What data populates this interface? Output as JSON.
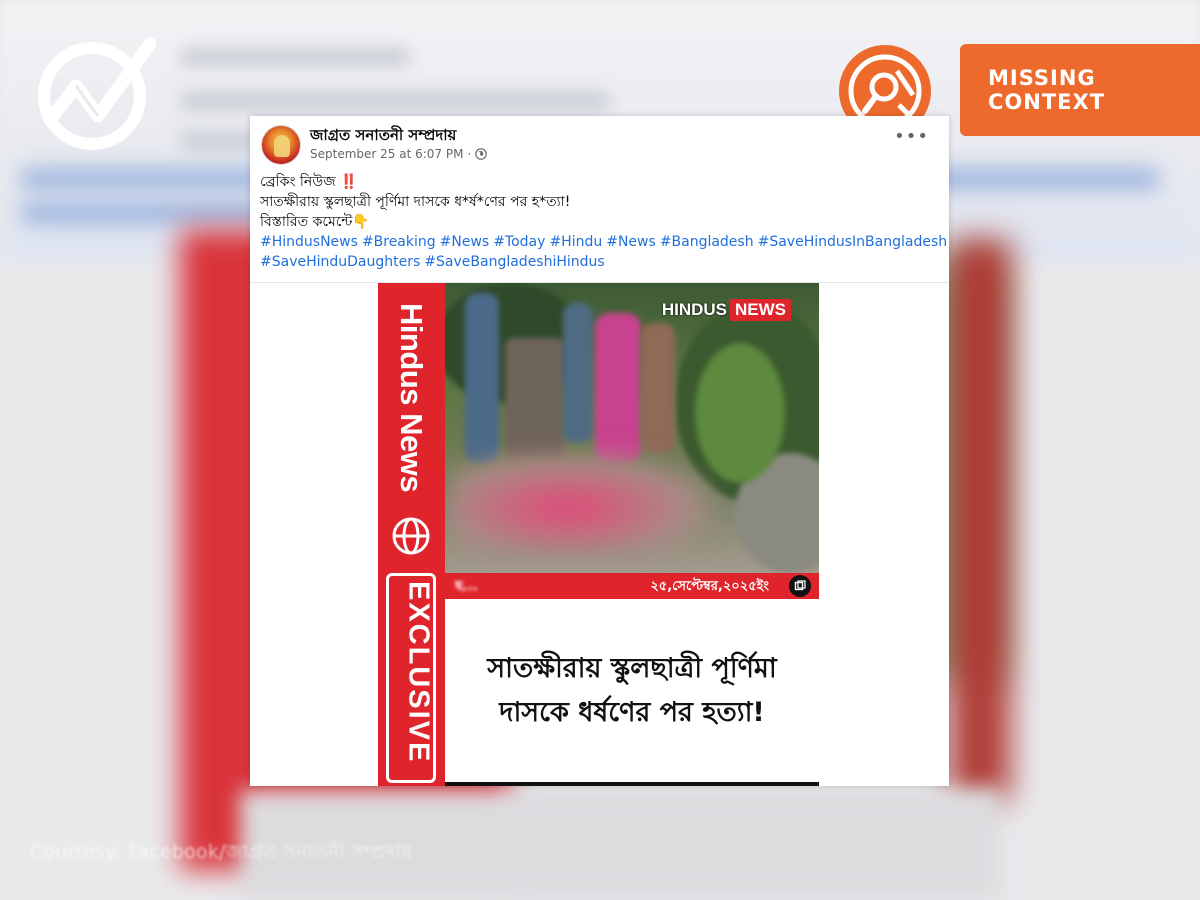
{
  "background": {
    "courtesy": "Courtesy: Facebook/জাগ্রত সনাতনী সম্প্রদায়"
  },
  "badge": {
    "label": "MISSING CONTEXT",
    "accent": "#ee6a2c",
    "icon": "magnifier-icon"
  },
  "site_logo": {
    "icon": "check-chart-logo"
  },
  "post": {
    "page_name": "জাগ্রত সনাতনী সম্প্রদায়",
    "timestamp": "September 25 at 6:07 PM",
    "separator": "·",
    "privacy_icon": "globe-icon",
    "more_label": "•••",
    "text": {
      "line1": "ব্রেকিং নিউজ",
      "alert": "‼️",
      "line2": "সাতক্ষীরায় স্কুলছাত্রী পূর্ণিমা দাসকে ধ*র্ষ*ণের পর হ*ত্যা!",
      "line3": "বিস্তারিত কমেন্টে👇"
    },
    "hashtags": [
      "#HindusNews",
      "#Breaking",
      "#News",
      "#Today",
      "#Hindu",
      "#News",
      "#Bangladesh",
      "#SaveHindusInBangladesh",
      "#SaveHinduDaughters",
      "#SaveBangladeshiHindus"
    ],
    "link_color": "#216fdb"
  },
  "media": {
    "side_brand": "Hindus News",
    "side_exclusive": "EXCLUSIVE",
    "tag_white": "HINDUS",
    "tag_red": "NEWS",
    "caption_left": "ছ...",
    "caption_date": "২৫,সেপ্টেম্বর,২০২৫ইং",
    "headline": "সাতক্ষীরায় স্কুলছাত্রী পূর্ণিমা দাসকে ধর্ষণের পর হত্যা!",
    "brand_color": "#e0242b"
  }
}
